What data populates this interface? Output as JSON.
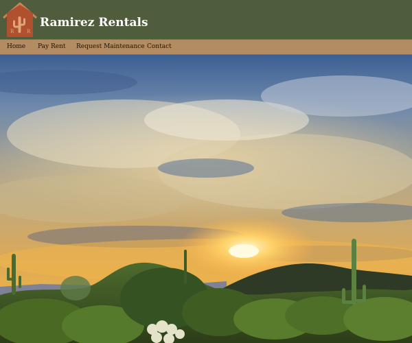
{
  "header": {
    "title": "Ramirez Rentals",
    "logo_icon": "adobe-house-cactus-icon",
    "logo_letters": [
      "R",
      "R"
    ],
    "background_color": "#4f5d3c"
  },
  "nav": {
    "background_color": "#b38c63",
    "items": [
      {
        "label": "Home"
      },
      {
        "label": "Pay Rent"
      },
      {
        "label": "Request Maintenance"
      },
      {
        "label": "Contact"
      }
    ]
  },
  "hero": {
    "image": "desert-sunset-with-saguaro-cacti-photo"
  }
}
